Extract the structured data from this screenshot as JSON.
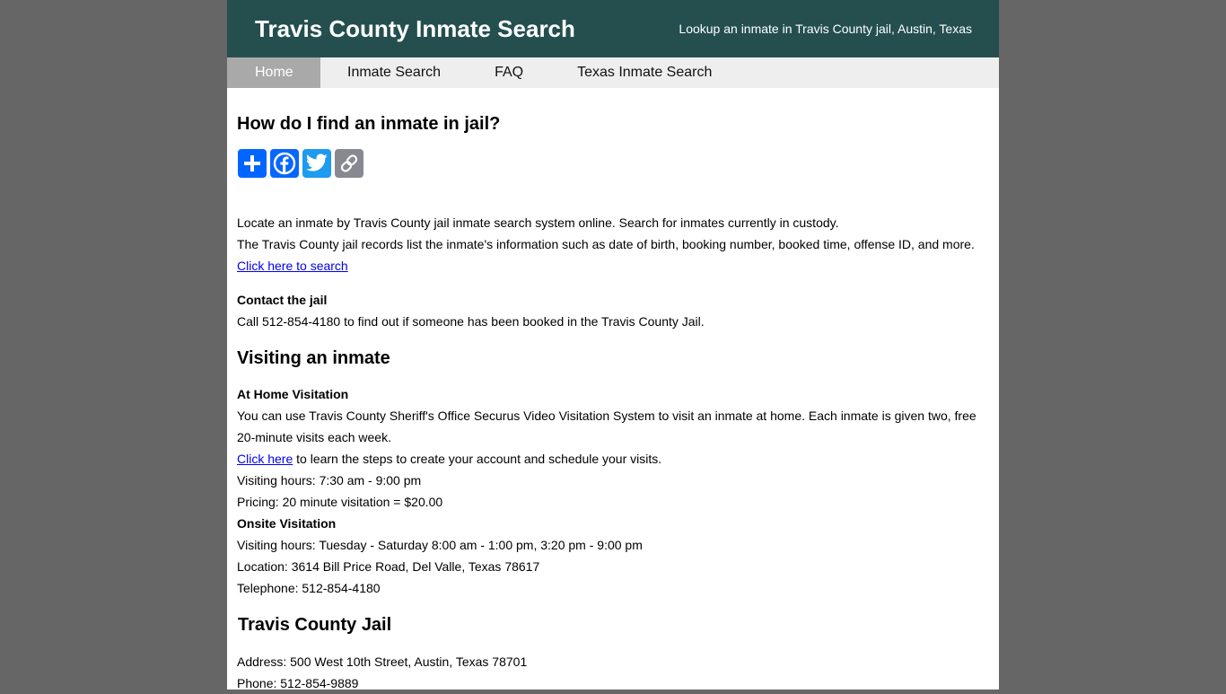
{
  "header": {
    "title": "Travis County Inmate Search",
    "tagline": "Lookup an inmate in Travis County jail, Austin, Texas"
  },
  "nav": {
    "items": [
      {
        "label": "Home",
        "active": true
      },
      {
        "label": "Inmate Search",
        "active": false
      },
      {
        "label": "FAQ",
        "active": false
      },
      {
        "label": "Texas Inmate Search",
        "active": false
      }
    ]
  },
  "colors": {
    "header_bg": "#254f4f",
    "nav_bg": "#eeeeee",
    "nav_active_bg": "#a9a9a9",
    "page_bg": "#666666",
    "share_add": "#0166ff",
    "share_facebook": "#0866ff",
    "share_twitter": "#1d9bf0",
    "share_copy": "#888990",
    "link": "#0000ee"
  },
  "main": {
    "question_heading": "How do I find an inmate in jail?",
    "share_buttons": [
      {
        "icon": "plus-icon",
        "label": "Share"
      },
      {
        "icon": "facebook-icon",
        "label": "Facebook"
      },
      {
        "icon": "twitter-icon",
        "label": "Twitter"
      },
      {
        "icon": "link-icon",
        "label": "Copy Link"
      }
    ],
    "intro_line1": "Locate an inmate by Travis County jail inmate search system online. Search for inmates currently in custody.",
    "intro_line2": "The Travis County jail records list the inmate's information such as date of birth, booking number, booked time, offense ID, and more.",
    "search_link": "Click here to search",
    "contact_heading": "Contact the jail",
    "contact_text": "Call 512-854-4180 to find out if someone has been booked in the Travis County Jail.",
    "visiting_heading": "Visiting an inmate",
    "home_visit_heading": "At Home Visitation",
    "home_visit_text": "You can use Travis County Sheriff's Office Securus Video Visitation System to visit an inmate at home. Each inmate is given two, free 20-minute visits each week.",
    "click_here_link": "Click here",
    "click_here_suffix": " to learn the steps to create your account and schedule your visits.",
    "home_hours": "Visiting hours: 7:30 am - 9:00 pm",
    "home_pricing": "Pricing: 20 minute visitation = $20.00",
    "onsite_heading": "Onsite Visitation",
    "onsite_hours": "Visiting hours: Tuesday - Saturday 8:00 am - 1:00 pm, 3:20 pm - 9:00 pm",
    "onsite_location": "Location: 3614 Bill Price Road, Del Valle, Texas 78617",
    "onsite_phone": "Telephone: 512-854-4180",
    "jail_heading": "Travis County Jail",
    "jail_address": "Address: 500 West 10th Street, Austin, Texas 78701",
    "jail_phone": "Phone: 512-854-9889"
  }
}
